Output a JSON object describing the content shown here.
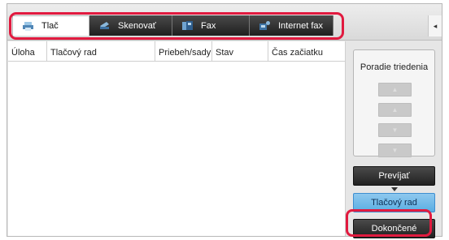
{
  "tabs": [
    {
      "label": "Tlač",
      "icon": "printer-icon",
      "active": true
    },
    {
      "label": "Skenovať",
      "icon": "scanner-icon",
      "active": false
    },
    {
      "label": "Fax",
      "icon": "fax-icon",
      "active": false
    },
    {
      "label": "Internet fax",
      "icon": "internet-fax-icon",
      "active": false
    }
  ],
  "collapse_glyph": "◂",
  "table": {
    "columns": [
      "Úloha",
      "Tlačový rad",
      "Priebeh/sady",
      "Stav",
      "Čas začiatku"
    ]
  },
  "sort": {
    "title": "Poradie triedenia",
    "buttons": [
      "▲",
      "▲",
      "▼",
      "▼"
    ]
  },
  "buttons": {
    "override": "Prevíjať",
    "queue": "Tlačový rad",
    "completed": "Dokončené"
  },
  "colors": {
    "highlight": "#e11a3f",
    "active_blue": "#5aaee3"
  }
}
